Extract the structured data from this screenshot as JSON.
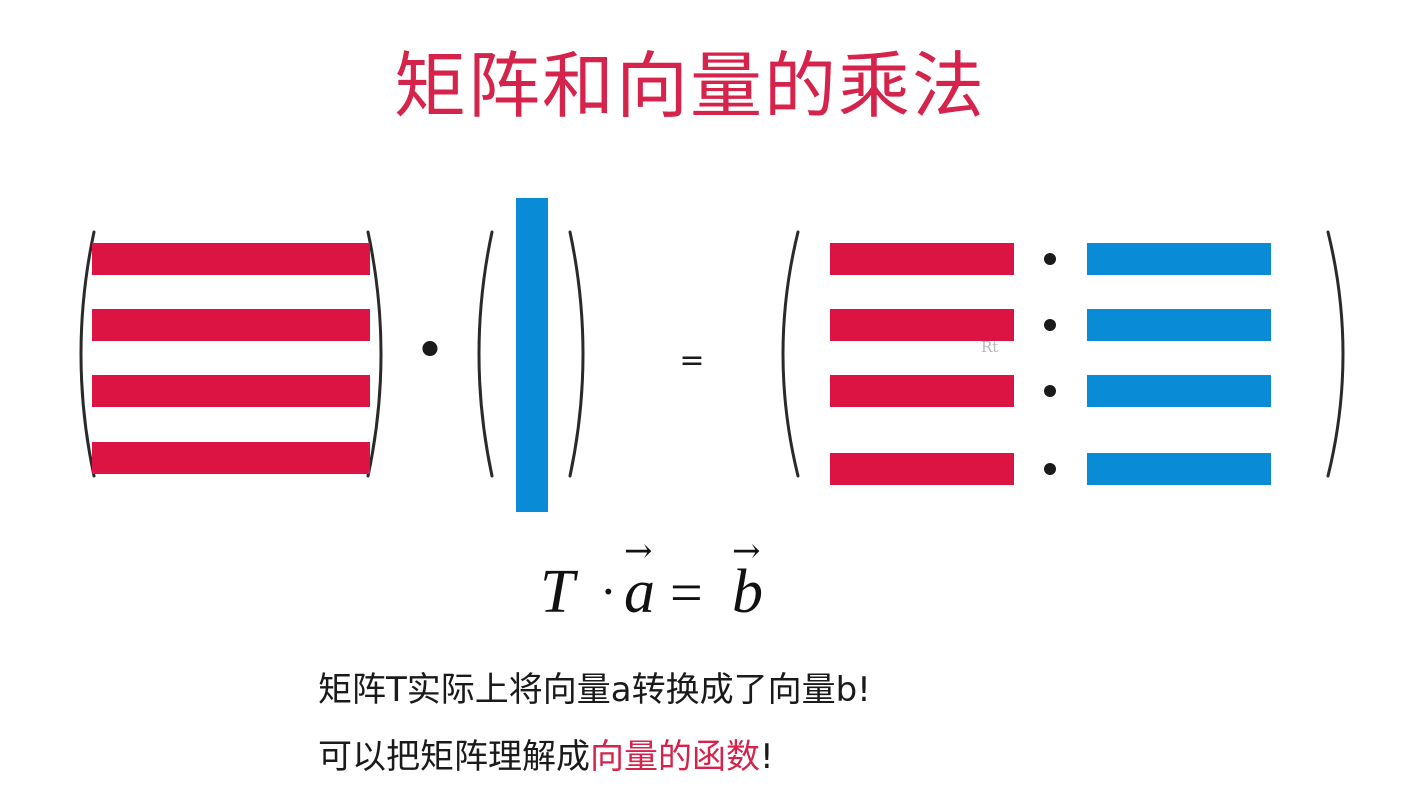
{
  "title": "矩阵和向量的乘法",
  "colors": {
    "row_red": "#dc1443",
    "column_blue": "#0a8bd6",
    "title_red": "#d5234b",
    "highlight_red": "#d5234b"
  },
  "diagram": {
    "matrix_rows": 4,
    "vector_columns": 1,
    "result_rows": 4,
    "operator_dot": "•",
    "equals": "="
  },
  "formula": {
    "lhs_matrix": "T",
    "operator": "·",
    "vector_a": "a",
    "equals": "=",
    "vector_b": "b",
    "arrow": "→"
  },
  "captions": {
    "line1": "矩阵T实际上将向量a转换成了向量b!",
    "line2_prefix": "可以把矩阵理解成",
    "line2_highlight": "向量的函数",
    "line2_suffix": "!"
  },
  "watermark": "Rt"
}
